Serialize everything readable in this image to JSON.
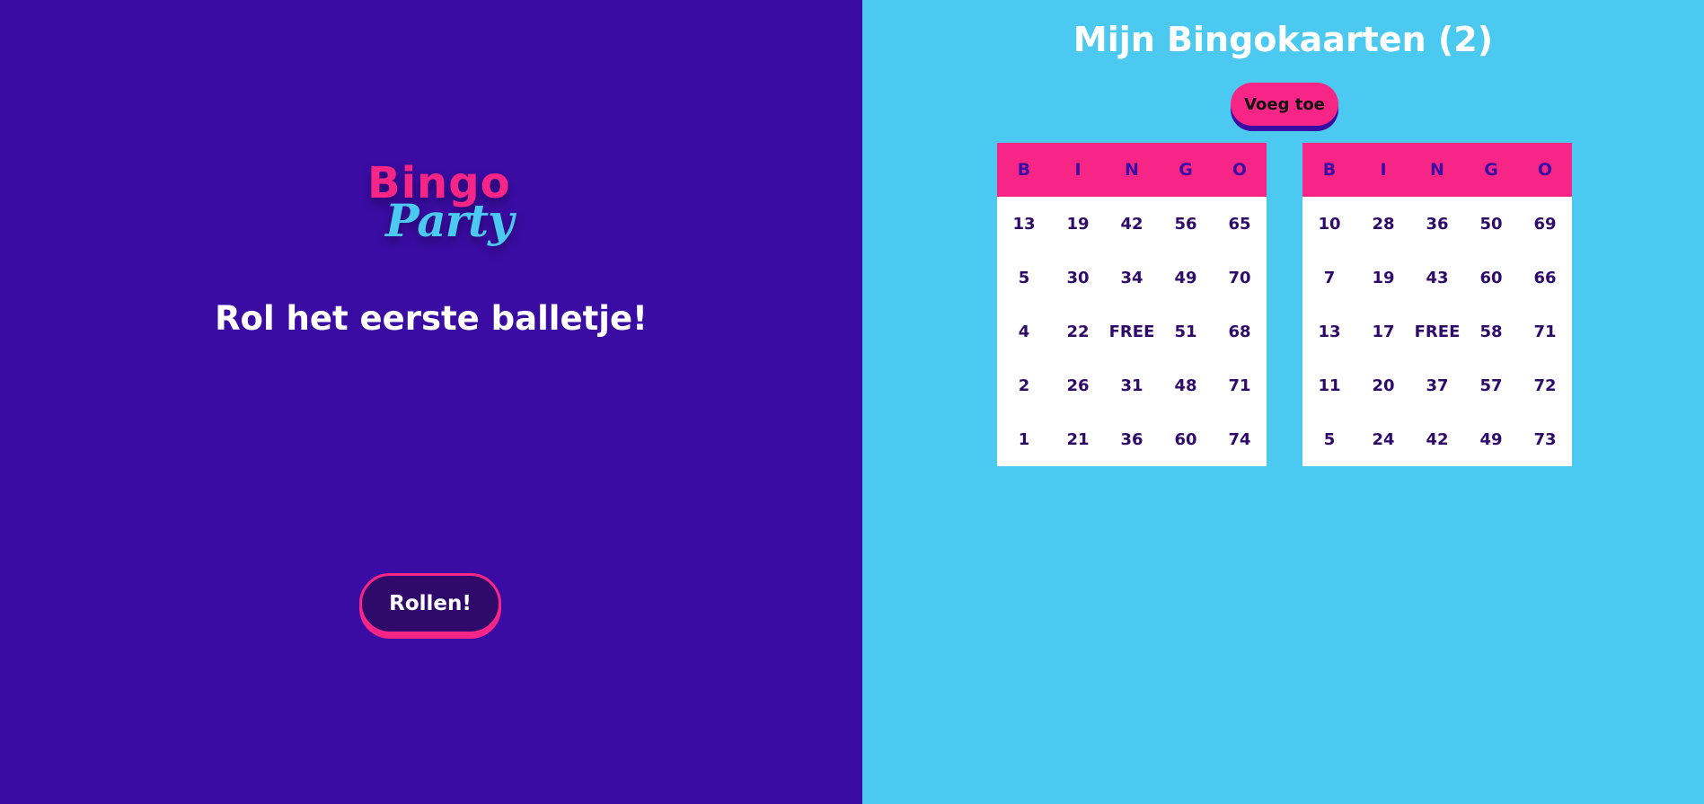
{
  "logo": {
    "line1": "Bingo",
    "line2": "Party"
  },
  "roll_prompt": "Rol het eerste balletje!",
  "roll_button": "Rollen!",
  "cards_title": "Mijn Bingokaarten (2)",
  "add_button": "Voeg toe",
  "headers": [
    "B",
    "I",
    "N",
    "G",
    "O"
  ],
  "cards": [
    {
      "rows": [
        [
          "13",
          "19",
          "42",
          "56",
          "65"
        ],
        [
          "5",
          "30",
          "34",
          "49",
          "70"
        ],
        [
          "4",
          "22",
          "FREE",
          "51",
          "68"
        ],
        [
          "2",
          "26",
          "31",
          "48",
          "71"
        ],
        [
          "1",
          "21",
          "36",
          "60",
          "74"
        ]
      ]
    },
    {
      "rows": [
        [
          "10",
          "28",
          "36",
          "50",
          "69"
        ],
        [
          "7",
          "19",
          "43",
          "60",
          "66"
        ],
        [
          "13",
          "17",
          "FREE",
          "58",
          "71"
        ],
        [
          "11",
          "20",
          "37",
          "57",
          "72"
        ],
        [
          "5",
          "24",
          "42",
          "49",
          "73"
        ]
      ]
    }
  ],
  "colors": {
    "left_bg": "#3a0ca3",
    "right_bg": "#4cc9f0",
    "accent": "#f72585"
  }
}
